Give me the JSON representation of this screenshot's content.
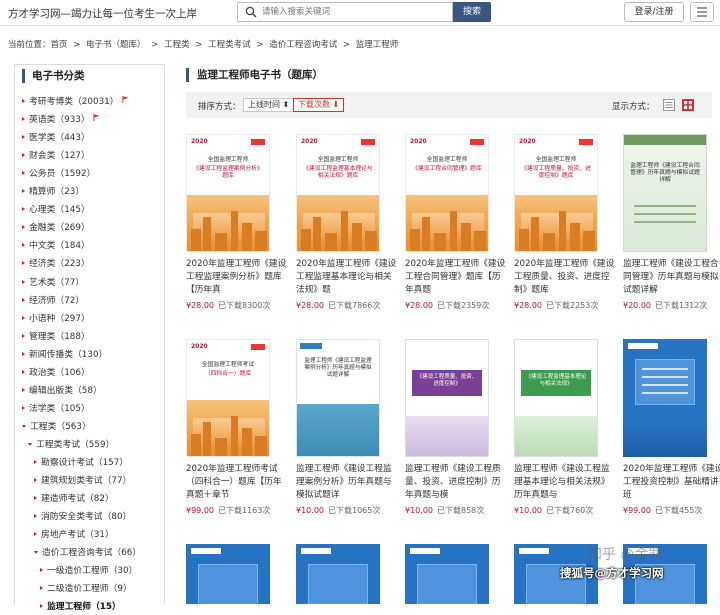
{
  "header": {
    "site_slogan": "方才学习网—竭力让每一位考生一次上岸",
    "search_placeholder": "请输入搜索关键词",
    "search_button": "搜索",
    "login_button": "登录/注册"
  },
  "breadcrumb": [
    "当前位置：首页",
    ">",
    "电子书（题库）",
    ">",
    "工程类",
    ">",
    "工程类考试",
    ">",
    "造价工程咨询考试",
    ">",
    "监理工程师"
  ],
  "sidebar": {
    "title": "电子书分类",
    "items": [
      {
        "label": "考研考博类（20031）",
        "flag": true
      },
      {
        "label": "英语类（933）",
        "flag": true
      },
      {
        "label": "医学类（443）"
      },
      {
        "label": "财会类（127）"
      },
      {
        "label": "公务员（1592）"
      },
      {
        "label": "精算师（23）"
      },
      {
        "label": "心理类（145）"
      },
      {
        "label": "金融类（269）"
      },
      {
        "label": "中文类（184）"
      },
      {
        "label": "经济类（223）"
      },
      {
        "label": "艺术类（77）"
      },
      {
        "label": "经济师（72）"
      },
      {
        "label": "小语种（297）"
      },
      {
        "label": "管理类（188）"
      },
      {
        "label": "新闻传播类（130）"
      },
      {
        "label": "政治类（106）"
      },
      {
        "label": "编辑出版类（58）"
      },
      {
        "label": "法学类（105）"
      },
      {
        "label": "工程类（563）",
        "expanded": true
      },
      {
        "label": "工程类考试（559）",
        "expanded": true
      },
      {
        "label": "勘察设计考试（157）"
      },
      {
        "label": "建筑规划类考试（77）"
      },
      {
        "label": "建造师考试（82）"
      },
      {
        "label": "消防安全类考试（80）"
      },
      {
        "label": "房地产考试（31）"
      },
      {
        "label": "造价工程咨询考试（66）",
        "expanded": true
      },
      {
        "label": "一级造价工程师（30）"
      },
      {
        "label": "二级造价工程师（9）"
      },
      {
        "label": "监理工程师（15）",
        "active": true
      }
    ]
  },
  "main": {
    "title": "监理工程师电子书（题库）",
    "sort_label": "排序方式：",
    "sort_options": [
      "上线时间",
      "下载次数"
    ],
    "display_label": "显示方式：",
    "books": [
      {
        "title": "2020年监理工程师《建设工程监理案例分析》题库【历年真",
        "price": "¥28.00",
        "sold": "已下载8300次",
        "cover": "orange",
        "cover_year": "2020",
        "cover_t1": "全国监理工程师",
        "cover_t2": "《建设工程监理案例分析》题库"
      },
      {
        "title": "2020年监理工程师《建设工程监理基本理论与相关法规》题",
        "price": "¥28.00",
        "sold": "已下载7866次",
        "cover": "orange",
        "cover_year": "2020",
        "cover_t1": "全国监理工程师",
        "cover_t2": "《建设工程监理基本理论与相关法规》题库"
      },
      {
        "title": "2020年监理工程师《建设工程合同管理》题库【历年真题",
        "price": "¥28.00",
        "sold": "已下载2359次",
        "cover": "orange",
        "cover_year": "2020",
        "cover_t1": "全国监理工程师",
        "cover_t2": "《建设工程合同管理》题库"
      },
      {
        "title": "2020年监理工程师《建设工程质量、投资、进度控制》题库",
        "price": "¥28.00",
        "sold": "已下载2253次",
        "cover": "orange",
        "cover_year": "2020",
        "cover_t1": "全国监理工程师",
        "cover_t2": "《建设工程质量、投资、进度控制》题库"
      },
      {
        "title": "监理工程师《建设工程合同管理》历年真题与模拟试题详解",
        "price": "¥20.00",
        "sold": "已下载1312次",
        "cover": "green",
        "cover_t1": "监理工程师《建设工程合同管理》历年真题与模拟试题详解"
      },
      {
        "title": "2020年监理工程师考试（四科合一）题库【历年真题＋章节",
        "price": "¥99.00",
        "sold": "已下载1163次",
        "cover": "orange",
        "cover_year": "2020",
        "cover_t1": "全国监理工程师考试",
        "cover_t2": "（四科合一）题库"
      },
      {
        "title": "监理工程师《建设工程监理案例分析》历年真题与模拟试题详",
        "price": "¥10.00",
        "sold": "已下载1065次",
        "cover": "teal",
        "cover_t1": "监理工程师《建设工程监理案例分析》历年真题与模拟试题详解"
      },
      {
        "title": "监理工程师《建设工程质量、投资、进度控制》历年真题与模",
        "price": "¥10.00",
        "sold": "已下载858次",
        "cover": "purple",
        "cover_t1": "《建设工程质量、投资、进度控制》"
      },
      {
        "title": "监理工程师《建设工程监理基本理论与相关法规》历年真题与",
        "price": "¥10.00",
        "sold": "已下载760次",
        "cover": "green2",
        "cover_t1": "《建设工程监理基本理论与相关法规》"
      },
      {
        "title": "2020年监理工程师《建设工程投资控制》基础精讲班",
        "price": "¥99.00",
        "sold": "已下载455次",
        "cover": "blue"
      }
    ]
  },
  "watermark": {
    "zhihu": "知乎 @金罪",
    "sohu": "搜狐号@方才学习网"
  },
  "colors": {
    "accent": "#3a5683",
    "price_red": "#c8102e",
    "triangle_red": "#cc2222"
  }
}
